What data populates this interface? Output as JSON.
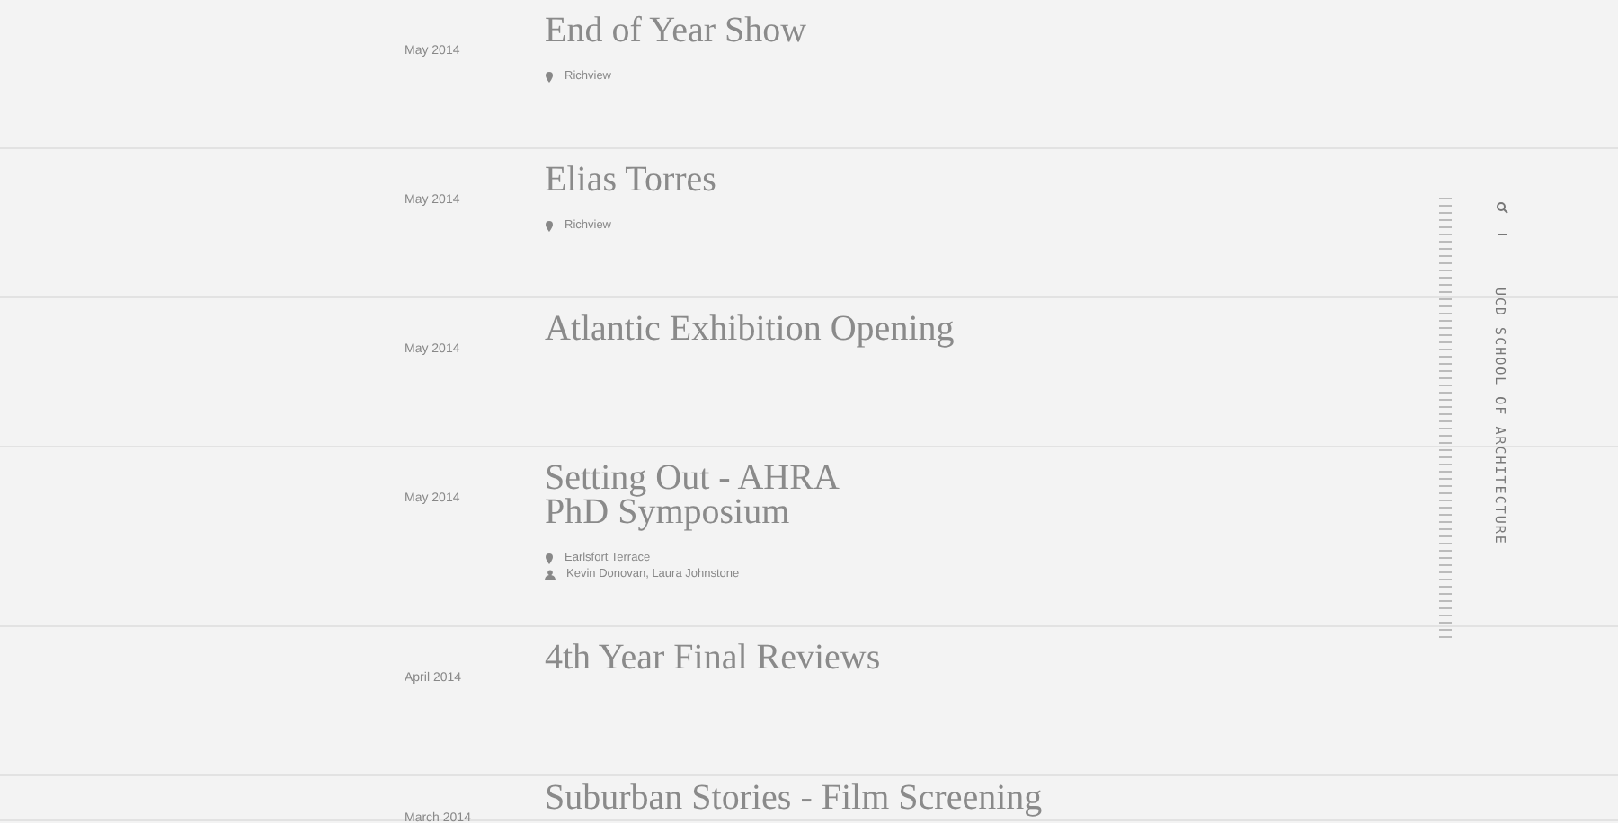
{
  "events": [
    {
      "date": "May 2014",
      "title_lines": [
        "End of Year Show"
      ],
      "meta": [
        {
          "kind": "location",
          "text": "Richview"
        }
      ]
    },
    {
      "date": "May 2014",
      "title_lines": [
        "Elias Torres"
      ],
      "meta": [
        {
          "kind": "location",
          "text": "Richview"
        }
      ]
    },
    {
      "date": "May 2014",
      "title_lines": [
        "Atlantic Exhibition Opening"
      ]
    },
    {
      "date": "May 2014",
      "title_lines": [
        "Setting Out - AHRA",
        "PhD Symposium"
      ],
      "meta": [
        {
          "kind": "location",
          "text": "Earlsfort Terrace"
        },
        {
          "kind": "people",
          "text": "Kevin Donovan, Laura Johnstone"
        }
      ]
    },
    {
      "date": "April 2014",
      "title_lines": [
        "4th Year Final Reviews"
      ]
    },
    {
      "date": "March 2014",
      "title_lines": [
        "Suburban Stories - Film Screening"
      ]
    }
  ],
  "sidebar": {
    "site_name": "UCD SCHOOL OF ARCHITECTURE"
  }
}
